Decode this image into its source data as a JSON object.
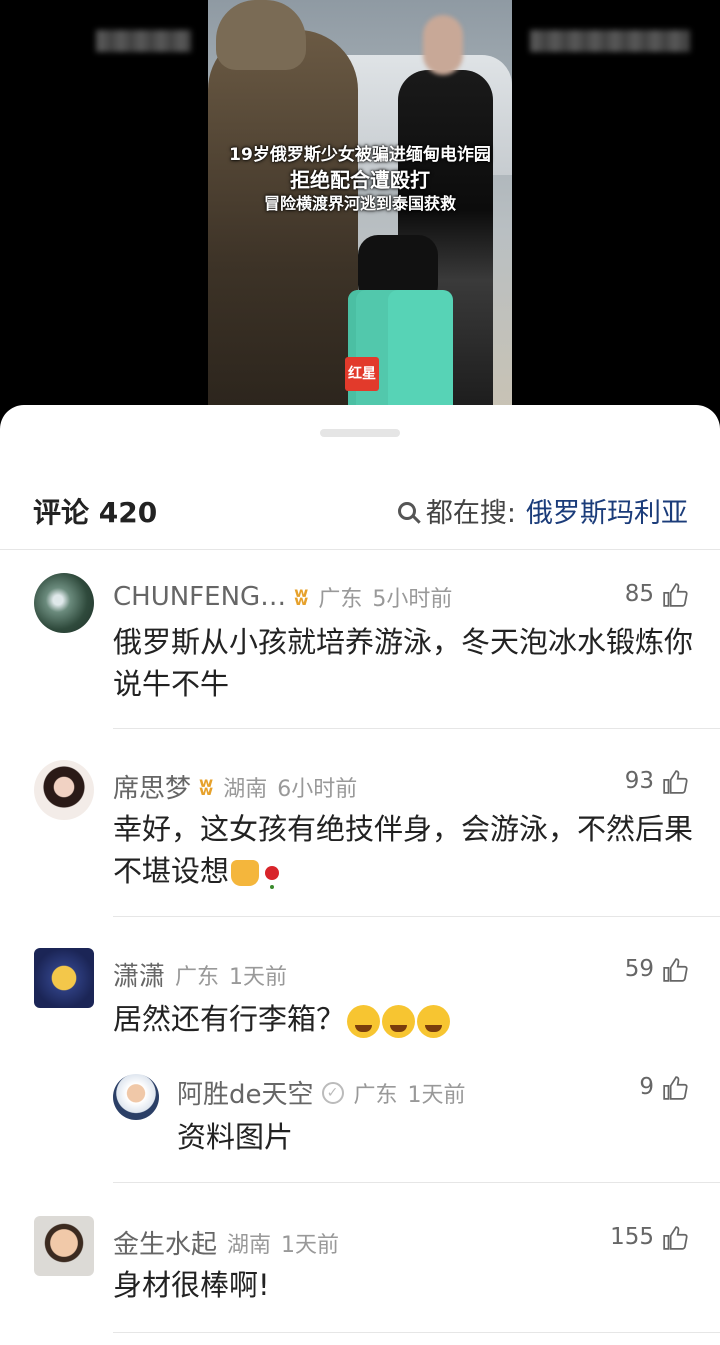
{
  "video": {
    "caption_line1": "19岁俄罗斯少女被骗进缅甸电诈园",
    "caption_line2": "拒绝配合遭殴打",
    "caption_line3": "冒险横渡界河逃到泰国获救",
    "logo_text": "红星"
  },
  "header": {
    "title": "评论 420",
    "search_prefix": "都在搜:",
    "search_keyword": "俄罗斯玛利亚"
  },
  "comments": [
    {
      "name": "CHUNFENG…",
      "location": "广东",
      "time": "5小时前",
      "likes": "85",
      "text": "俄罗斯从小孩就培养游泳，冬天泡冰水锻炼你说牛不牛"
    },
    {
      "name": "席思梦",
      "location": "湖南",
      "time": "6小时前",
      "likes": "93",
      "text": "幸好，这女孩有绝技伴身，会游泳，不然后果不堪设想"
    },
    {
      "name": "潇潇",
      "location": "广东",
      "time": "1天前",
      "likes": "59",
      "text": "居然还有行李箱？"
    },
    {
      "name": "金生水起",
      "location": "湖南",
      "time": "1天前",
      "likes": "155",
      "text": "身材很棒啊!"
    }
  ],
  "reply": {
    "name": "阿胜de天空",
    "location": "广东",
    "time": "1天前",
    "likes": "9",
    "text": "资料图片"
  },
  "icons": [
    "search-icon",
    "thumb-up-icon",
    "vip-badge-icon",
    "verified-icon",
    "praying-hands-emoji",
    "rose-emoji",
    "laughing-crying-emoji"
  ],
  "colors": {
    "keyword": "#1b3c7a",
    "vip": "#e6a12b",
    "meta": "#999999"
  }
}
